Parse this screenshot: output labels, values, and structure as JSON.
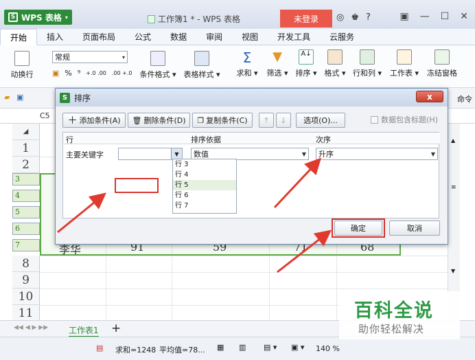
{
  "app": {
    "name": "WPS 表格",
    "doc_title": "工作簿1 * - WPS 表格",
    "login": "未登录",
    "help": "?"
  },
  "tabs": [
    "开始",
    "插入",
    "页面布局",
    "公式",
    "数据",
    "审阅",
    "视图",
    "开发工具",
    "云服务"
  ],
  "ribbon": {
    "wrap": "动换行",
    "format_value": "常规",
    "percent": "%",
    "comma": "⁹",
    "dec_inc": "+.0 .00",
    "dec_dec": ".00 +.0",
    "cond_format": "条件格式",
    "table_style": "表格样式",
    "sum": "求和",
    "filter": "筛选",
    "sort": "排序",
    "format": "格式",
    "rows_cols": "行和列",
    "worksheet": "工作表",
    "freeze": "冻结窗格"
  },
  "quickbar": {
    "right_text": "命令"
  },
  "cellref": "C5",
  "rows": [
    "1",
    "2",
    "3",
    "4",
    "5",
    "6",
    "7",
    "8",
    "9",
    "10",
    "11"
  ],
  "row7": {
    "name": "李华",
    "v1": "91",
    "v2": "59",
    "v3": "71",
    "v4": "68"
  },
  "dialog": {
    "title": "排序",
    "close": "x",
    "add_condition": "添加条件(A)",
    "delete_condition": "删除条件(D)",
    "copy_condition": "复制条件(C)",
    "options": "选项(O)...",
    "header_checkbox": "数据包含标题(H)",
    "col_headers": [
      "行",
      "排序依据",
      "次序"
    ],
    "key_label": "主要关键字",
    "sort_by": "数值",
    "order": "升序",
    "dropdown_items": [
      "行 3",
      "行 4",
      "行 5",
      "行 6",
      "行 7"
    ],
    "ok": "确定",
    "cancel": "取消"
  },
  "sheet": {
    "tab": "工作表1",
    "add": "+"
  },
  "status": {
    "sum": "求和=1248",
    "avg": "平均值=78...",
    "zoom": "140 %"
  },
  "watermark": {
    "title": "百科全说",
    "subtitle": "助你轻松解决"
  },
  "colors": {
    "accent_green": "#2e8b3a",
    "highlight_red": "#d9322c",
    "selection_green": "#5ea84a"
  }
}
